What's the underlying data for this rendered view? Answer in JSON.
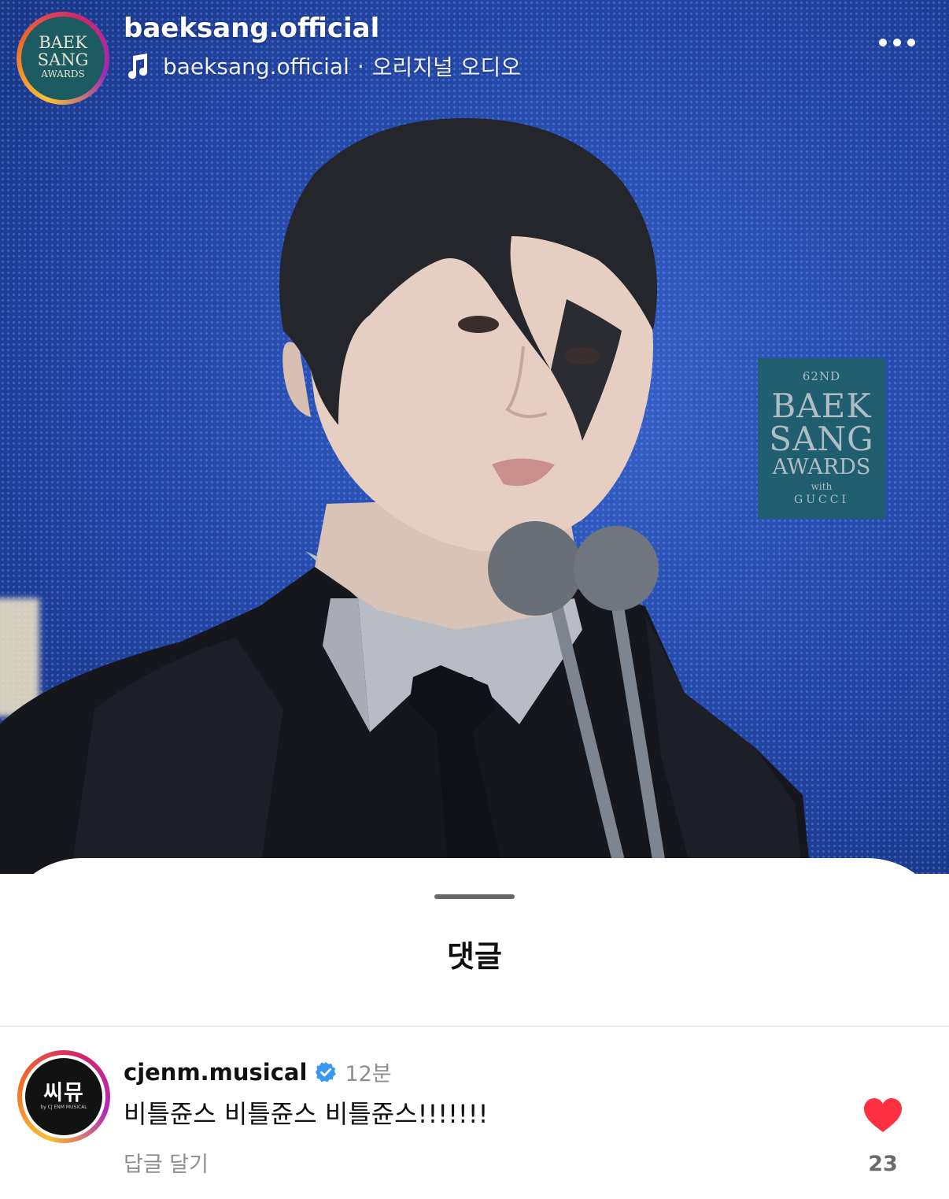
{
  "header": {
    "channel_name": "baeksang.official",
    "audio_author": "baeksang.official",
    "audio_separator": "·",
    "audio_label": "오리지널 오디오",
    "avatar_logo": [
      "BAEK",
      "SANG",
      "AWARDS"
    ],
    "icons": {
      "music": "music-note-icon",
      "more": "more-options-icon"
    }
  },
  "video": {
    "backdrop_logo": {
      "ordinal": "62ND",
      "line1": "BAEK",
      "line2": "SANG",
      "line3": "AWARDS",
      "with": "with",
      "brand": "GUCCI"
    }
  },
  "sheet": {
    "title": "댓글"
  },
  "comment": {
    "username": "cjenm.musical",
    "verified": true,
    "time": "12분",
    "text": "비틀쥰스 비틀쥰스 비틀쥰스!!!!!!!",
    "reply_label": "답글 달기",
    "likes": "23",
    "liked": true,
    "avatar_logo": "씨뮤",
    "avatar_sub": "by CJ ENM MUSICAL",
    "icons": {
      "verified": "verified-badge-icon",
      "heart": "heart-icon"
    }
  },
  "colors": {
    "accent_heart": "#ff3040",
    "verified_blue": "#3897f0",
    "muted_text": "#8e8e8e",
    "stage_blue": "#2a4fb2"
  }
}
